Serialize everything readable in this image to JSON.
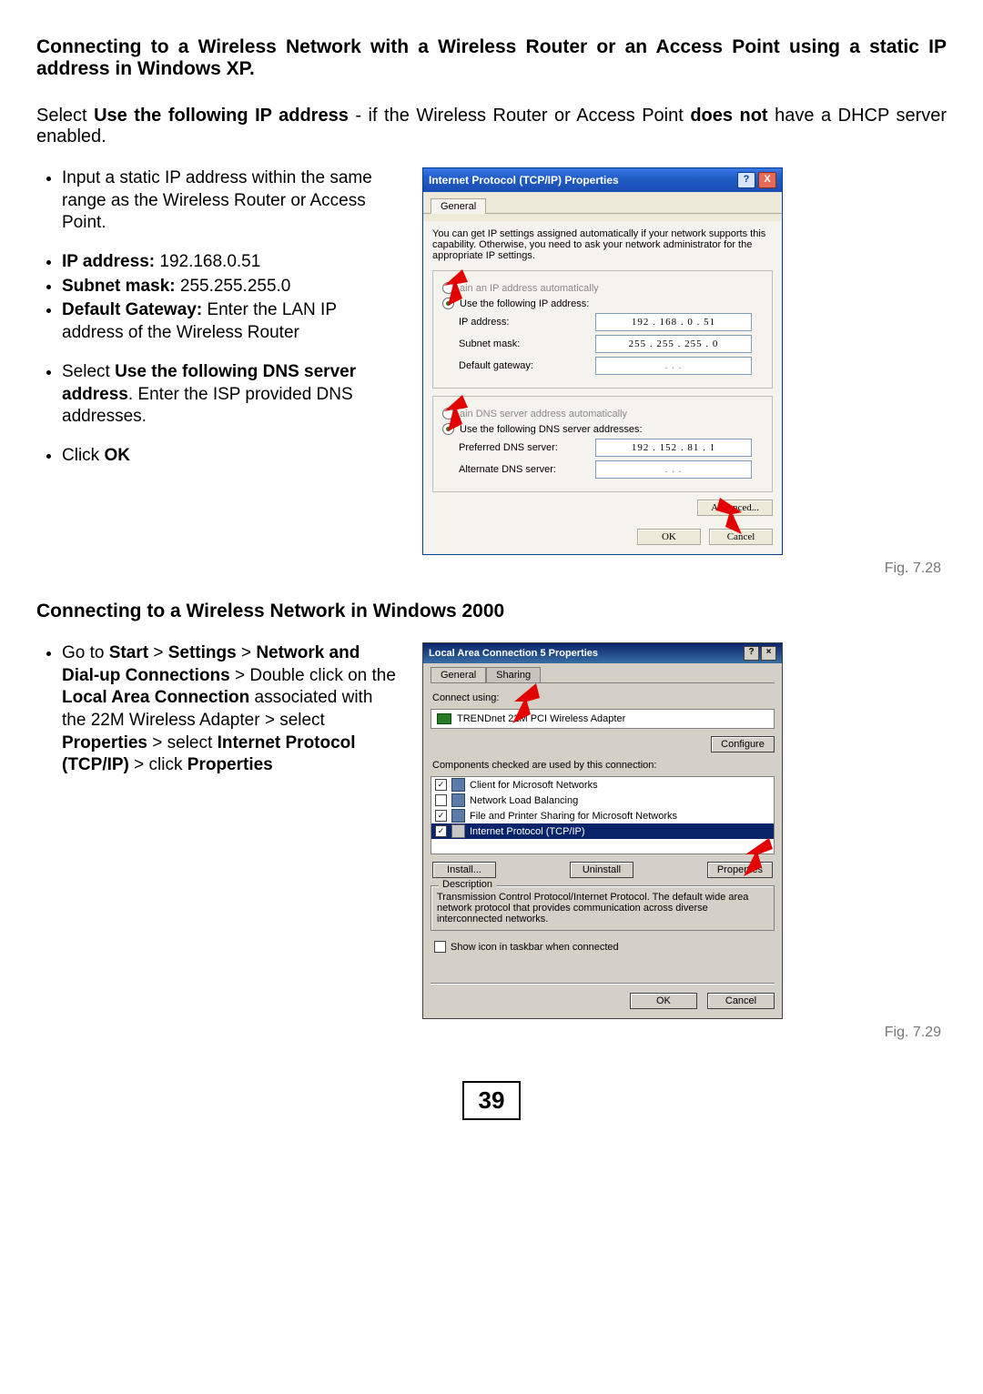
{
  "heading1": "Connecting to a Wireless Network with a Wireless Router or an Access Point using a static IP address in Windows XP.",
  "intro": {
    "pre": "Select ",
    "b1": "Use the following IP address",
    "mid": " - if the Wireless Router or Access Point ",
    "b2": "does not",
    "post": " have a DHCP server enabled."
  },
  "bullets1": {
    "b0": "Input a static IP address within the same range as the Wireless Router or Access Point.",
    "ip_label": "IP address:",
    "ip_val": " 192.168.0.51",
    "sm_label": "Subnet mask:",
    "sm_val": " 255.255.255.0",
    "gw_label": "Default Gateway:",
    "gw_val": " Enter the LAN IP   address of the Wireless Router",
    "dns_pre": "Select ",
    "dns_b": "Use the following DNS server address",
    "dns_post": ". Enter the ISP provided DNS addresses.",
    "ok_pre": "Click ",
    "ok_b": "OK"
  },
  "fig728": {
    "title": "Internet Protocol (TCP/IP) Properties",
    "tab": "General",
    "help_text": "You can get IP settings assigned automatically if your network supports this capability. Otherwise, you need to ask your network administrator for the appropriate IP settings.",
    "radio_auto_ip": "ain an IP address automatically",
    "radio_use_ip": "Use the following IP address:",
    "lbl_ip": "IP address:",
    "val_ip": "192 . 168 .  0  . 51",
    "lbl_sm": "Subnet mask:",
    "val_sm": "255 . 255 . 255 .  0",
    "lbl_gw": "Default gateway:",
    "val_gw": ".     .     .",
    "radio_auto_dns": "ain DNS server address automatically",
    "radio_use_dns": "Use the following DNS server addresses:",
    "lbl_pdns": "Preferred DNS server:",
    "val_pdns": "192 . 152 . 81  .  1",
    "lbl_adns": "Alternate DNS server:",
    "val_adns": ".     .     .",
    "btn_adv": "Advanced...",
    "btn_ok": "OK",
    "btn_cancel": "Cancel",
    "caption": "Fig. 7.28"
  },
  "heading2": "Connecting to a Wireless Network in Windows 2000",
  "bullets2": {
    "pre": "Go to ",
    "b1": "Start",
    "gt1": " > ",
    "b2": "Settings",
    "gt2": " > ",
    "b3": "Network and Dial-up Connections",
    "mid1": " > Double click on the ",
    "b4": "Local Area Connection",
    "mid2": " associated with the 22M Wireless Adapter > select ",
    "b5": "Properties",
    "mid3": " > select ",
    "b6": "Internet Protocol (TCP/IP)",
    "mid4": " > click ",
    "b7": "Properties"
  },
  "fig729": {
    "title": "Local Area Connection 5 Properties",
    "tab1": "General",
    "tab2": "Sharing",
    "connect_using": "Connect using:",
    "adapter": "TRENDnet 22M PCI Wireless Adapter",
    "btn_configure": "Configure",
    "components_label": "Components checked are used by this connection:",
    "items": [
      "Client for Microsoft Networks",
      "Network Load Balancing",
      "File and Printer Sharing for Microsoft Networks",
      "Internet Protocol (TCP/IP)"
    ],
    "btn_install": "Install...",
    "btn_uninstall": "Uninstall",
    "btn_properties": "Properties",
    "desc_legend": "Description",
    "desc_text": "Transmission Control Protocol/Internet Protocol. The default wide area network protocol that provides communication across diverse interconnected networks.",
    "show_icon": "Show icon in taskbar when connected",
    "btn_ok": "OK",
    "btn_cancel": "Cancel",
    "caption": "Fig. 7.29"
  },
  "page_number": "39"
}
